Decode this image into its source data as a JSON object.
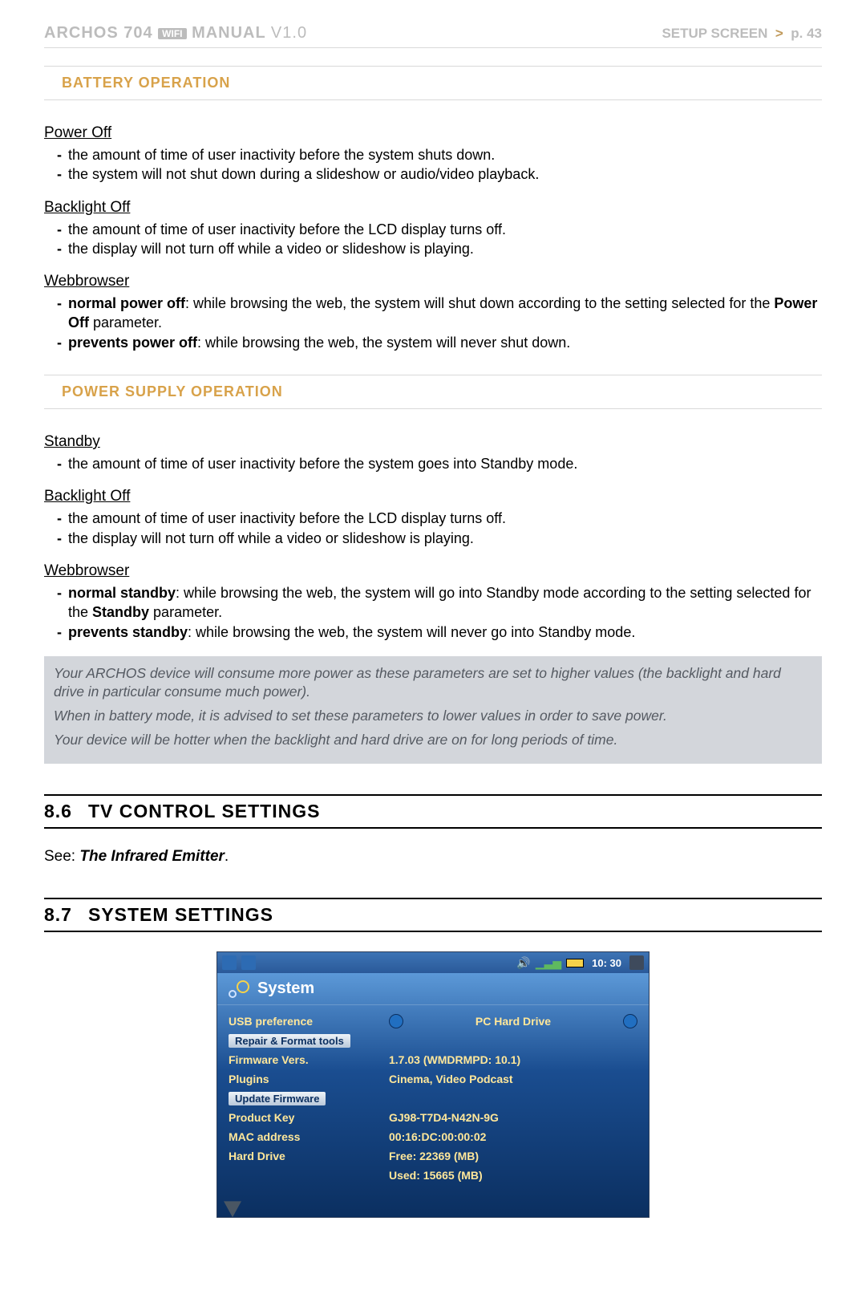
{
  "header": {
    "brand": "ARCHOS 704",
    "wifi_badge": "WIFI",
    "manual": "MANUAL",
    "version": "V1.0",
    "right_label": "SETUP SCREEN",
    "right_sep": ">",
    "right_page": "p. 43"
  },
  "battery_section_title": "BATTERY OPERATION",
  "battery": {
    "power_off": {
      "title": "Power Off",
      "line1": "the amount of time of user inactivity before the system shuts down.",
      "line2": "the system will not shut down during a slideshow or audio/video playback."
    },
    "backlight_off": {
      "title": "Backlight Off",
      "line1": "the amount of time of user inactivity before the LCD display turns off.",
      "line2": "the display will not turn off while a video or slideshow is playing."
    },
    "webbrowser": {
      "title": "Webbrowser",
      "normal_label": "normal power off",
      "normal_text_a": ": while browsing the web, the system will shut down according to the setting selected for the ",
      "normal_text_bold": "Power Off",
      "normal_text_b": " parameter.",
      "prevents_label": "prevents power off",
      "prevents_text": ": while browsing the web, the system will never shut down."
    }
  },
  "power_section_title": "POWER SUPPLY OPERATION",
  "power": {
    "standby": {
      "title": "Standby",
      "line1": "the amount of time of user inactivity before the system goes into Standby mode."
    },
    "backlight_off": {
      "title": "Backlight Off",
      "line1": "the amount of time of user inactivity before the LCD display turns off.",
      "line2": "the display will not turn off while a video or slideshow is playing."
    },
    "webbrowser": {
      "title": "Webbrowser",
      "normal_label": "normal standby",
      "normal_text_a": ": while browsing the web, the system will go into Standby mode according to the setting selected for the ",
      "normal_text_bold": "Standby",
      "normal_text_b": " parameter.",
      "prevents_label": "prevents standby",
      "prevents_text": ": while browsing the web, the system will never go into Standby mode."
    }
  },
  "note": {
    "p1": "Your ARCHOS device will consume more power as these parameters are set to higher values (the backlight and hard drive in particular consume much power).",
    "p2": "When in battery mode, it is advised to set these parameters to lower values in order to save power.",
    "p3": "Your device will be hotter when the backlight and hard drive are on for long periods of time."
  },
  "chapter_86": {
    "num": "8.6",
    "title": "TV CONTROL SETTINGS"
  },
  "see_line": {
    "prefix": "See: ",
    "ref": "The Infrared Emitter",
    "suffix": "."
  },
  "chapter_87": {
    "num": "8.7",
    "title": "SYSTEM SETTINGS"
  },
  "sys": {
    "time": "10: 30",
    "title": "System",
    "rows": {
      "usb_pref": {
        "label": "USB preference",
        "value": "PC Hard Drive"
      },
      "repair": {
        "label": "Repair & Format tools"
      },
      "fw_vers": {
        "label": "Firmware Vers.",
        "value": "1.7.03   (WMDRMPD: 10.1)"
      },
      "plugins": {
        "label": "Plugins",
        "value": "Cinema, Video Podcast"
      },
      "update_fw": {
        "label": "Update Firmware"
      },
      "pkey": {
        "label": "Product Key",
        "value": "GJ98-T7D4-N42N-9G"
      },
      "mac": {
        "label": "MAC address",
        "value": "00:16:DC:00:00:02"
      },
      "hdd": {
        "label": "Hard Drive",
        "free": "Free:  22369 (MB)",
        "used": "Used:  15665 (MB)"
      }
    }
  }
}
